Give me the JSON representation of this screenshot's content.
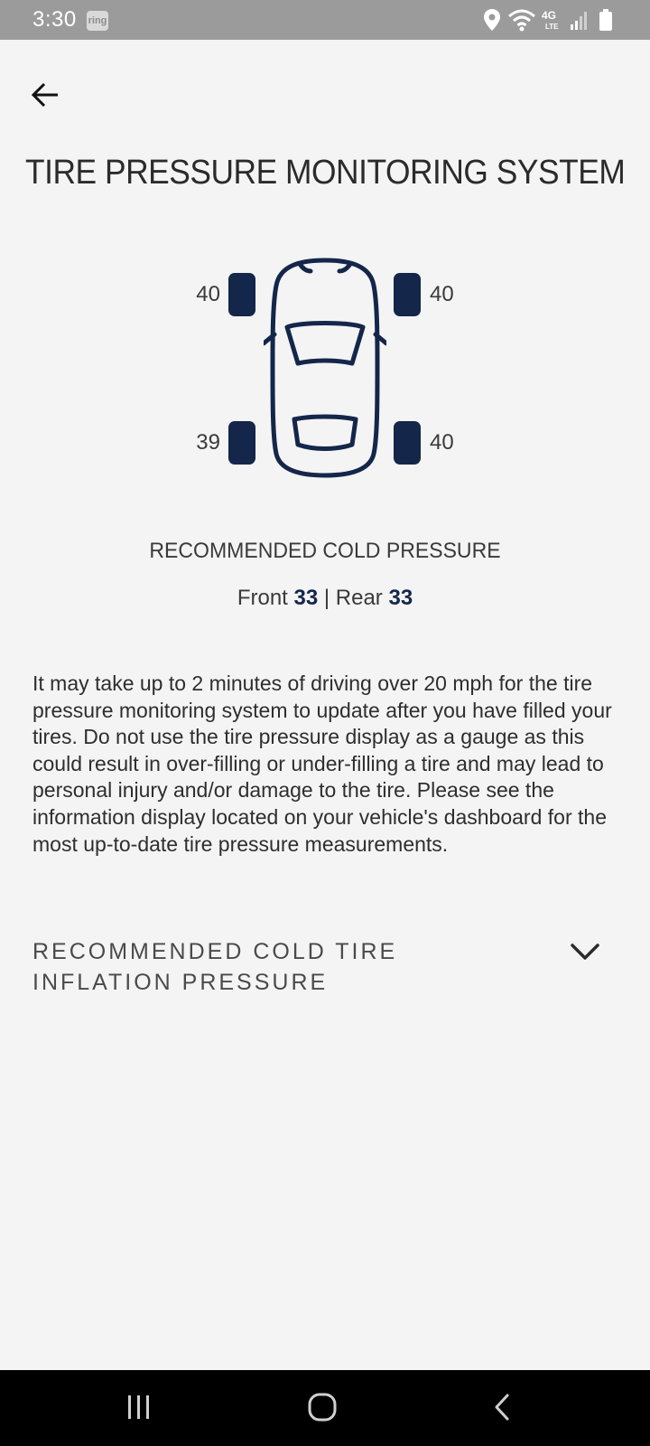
{
  "status_bar": {
    "time": "3:30",
    "ring_badge": "ring",
    "network_label": "4G LTE",
    "icons": [
      "location-icon",
      "wifi-icon",
      "signal-icon",
      "battery-icon"
    ]
  },
  "header": {
    "title": "TIRE PRESSURE MONITORING SYSTEM"
  },
  "tires": {
    "front_left": "40",
    "front_right": "40",
    "rear_left": "39",
    "rear_right": "40"
  },
  "recommended": {
    "heading": "RECOMMENDED COLD PRESSURE",
    "front_label": "Front",
    "front_value": "33",
    "separator": "|",
    "rear_label": "Rear",
    "rear_value": "33"
  },
  "info_text": "It may take up to 2 minutes of driving over 20 mph for the tire pressure monitoring system to update after you have filled your tires. Do not use the tire pressure display as a gauge as this could result in over-filling or under-filling a tire and may lead to personal injury and/or damage to the tire. Please see the information display located on your vehicle's dashboard for the most up-to-date tire pressure measurements.",
  "accordion": {
    "label": "RECOMMENDED COLD TIRE INFLATION PRESSURE"
  },
  "colors": {
    "accent": "#14264a",
    "background": "#f4f4f4",
    "status_bar": "#9b9b9b",
    "nav_bar": "#000000"
  }
}
